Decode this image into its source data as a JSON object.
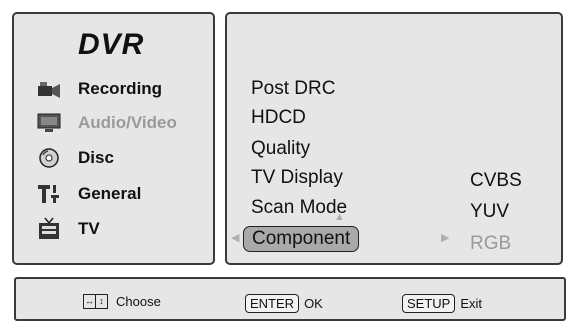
{
  "sidebar": {
    "title": "DVR",
    "items": [
      {
        "label": "Recording",
        "icon": "camcorder-icon"
      },
      {
        "label": "Audio/Video",
        "icon": "monitor-icon"
      },
      {
        "label": "Disc",
        "icon": "disc-icon"
      },
      {
        "label": "General",
        "icon": "general-settings-icon"
      },
      {
        "label": "TV",
        "icon": "tv-icon"
      }
    ],
    "active_item": "Audio/Video"
  },
  "menu": {
    "items": [
      "Post DRC",
      "HDCD",
      "Quality",
      "TV Display",
      "Scan Mode",
      "Component"
    ],
    "selected": "Component"
  },
  "options": {
    "items": [
      "CVBS",
      "YUV",
      "RGB"
    ],
    "current": "RGB"
  },
  "footer": {
    "choose_label": "Choose",
    "enter_key": "ENTER",
    "enter_label": "OK",
    "setup_key": "SETUP",
    "setup_label": "Exit"
  },
  "colors": {
    "panel": "#e6e6e6",
    "border": "#3a3a3a",
    "highlight": "#a9a9a9",
    "dimmed_text": "#9a9a9a"
  }
}
